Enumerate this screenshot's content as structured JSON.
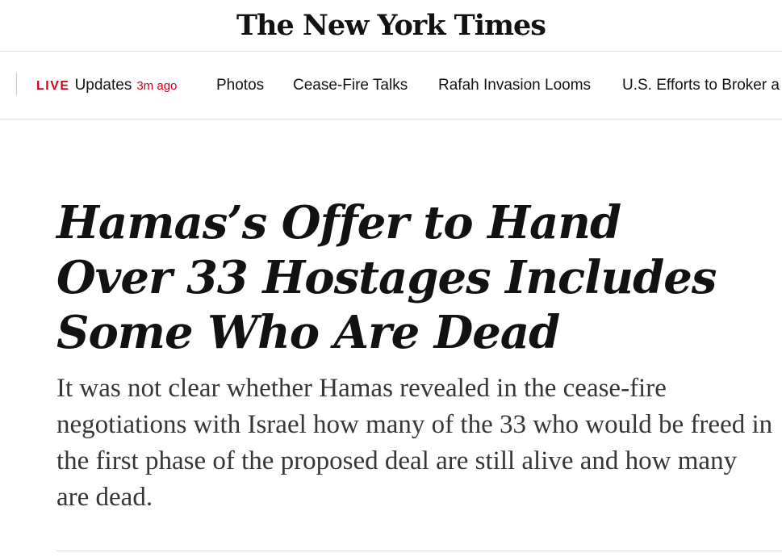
{
  "masthead": {
    "logo_text": "The New York Times"
  },
  "nav": {
    "live": {
      "badge": "LIVE",
      "label": "Updates",
      "time": "3m ago"
    },
    "items": [
      {
        "label": "Photos"
      },
      {
        "label": "Cease-Fire Talks"
      },
      {
        "label": "Rafah Invasion Looms"
      },
      {
        "label": "U.S. Efforts to Broker a"
      }
    ]
  },
  "article": {
    "headline": "Hamas’s Offer to Hand Over 33 Hostages Includes Some Who Are Dead",
    "summary": "It was not clear whether Hamas revealed in the cease-fire negotiations with Israel how many of the 33 who would be freed in the first phase of the proposed deal are still alive and how many are dead."
  },
  "colors": {
    "live_red": "#d0021b",
    "text": "#121212",
    "summary_text": "#363636",
    "rule": "#dfdfdf"
  }
}
